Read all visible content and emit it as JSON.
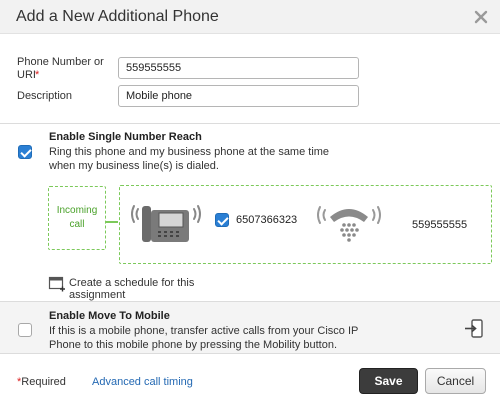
{
  "dialog": {
    "title": "Add a New Additional Phone"
  },
  "form": {
    "phone_label": "Phone Number or URI",
    "required_marker": "*",
    "phone_value": "559555555",
    "description_label": "Description",
    "description_value": "Mobile phone"
  },
  "single_number_reach": {
    "checked": true,
    "title": "Enable Single Number Reach",
    "description_line1": "Ring this phone and my business phone at the same time",
    "description_line2": "when my business line(s) is dialed.",
    "incoming_line1": "Incoming",
    "incoming_line2": "call",
    "business_line_checked": true,
    "business_number": "6507366323",
    "mobile_number": "559555555",
    "schedule_label": "Create a schedule for this assignment"
  },
  "move_to_mobile": {
    "checked": false,
    "title": "Enable Move To Mobile",
    "description_line1": "If this is a mobile phone, transfer active calls from your Cisco IP",
    "description_line2": "Phone to this mobile phone by pressing the Mobility button."
  },
  "footer": {
    "required_marker": "*",
    "required_text": "Required",
    "advanced_link": "Advanced call timing",
    "save_label": "Save",
    "cancel_label": "Cancel"
  },
  "colors": {
    "accent_blue": "#2a7fd4",
    "incoming_green": "#4aa12a",
    "save_dark": "#3c3c3c",
    "link_blue": "#2469b3"
  },
  "icons": [
    "close-icon",
    "desk-phone-icon",
    "ringing-phone-icon",
    "calendar-add-icon",
    "move-to-mobile-icon"
  ]
}
